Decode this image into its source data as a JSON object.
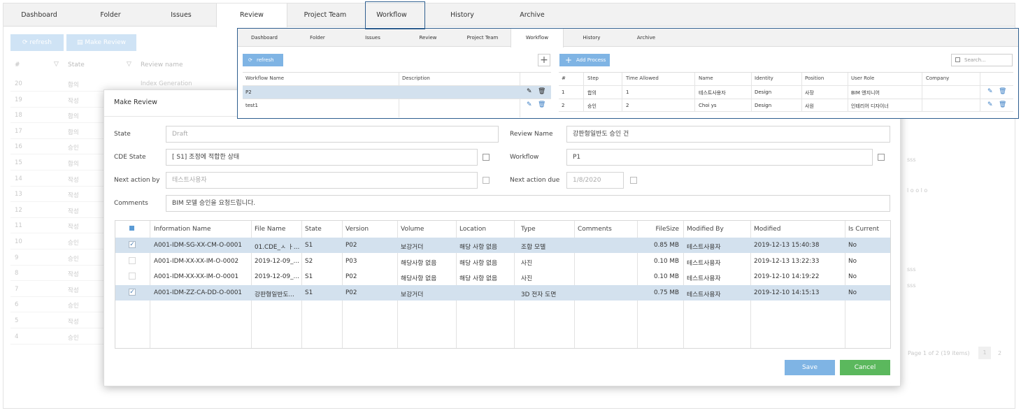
{
  "bg": {
    "tabs": [
      "Dashboard",
      "Folder",
      "Issues",
      "Review",
      "Project Team",
      "Workflow",
      "History",
      "Archive"
    ],
    "active_tab": "Review",
    "refresh_label": "refresh",
    "make_review_label": "Make Review",
    "header": {
      "number": "#",
      "state": "State",
      "name": "Review name"
    },
    "rows": [
      {
        "no": "20",
        "state": "합의",
        "name": "Index Generation"
      },
      {
        "no": "19",
        "state": "작성",
        "name": ""
      },
      {
        "no": "18",
        "state": "합의",
        "name": ""
      },
      {
        "no": "17",
        "state": "합의",
        "name": ""
      },
      {
        "no": "16",
        "state": "승인",
        "name": ""
      },
      {
        "no": "15",
        "state": "합의",
        "name": ""
      },
      {
        "no": "14",
        "state": "작성",
        "name": ""
      },
      {
        "no": "13",
        "state": "작성",
        "name": ""
      },
      {
        "no": "12",
        "state": "작성",
        "name": ""
      },
      {
        "no": "11",
        "state": "작성",
        "name": ""
      },
      {
        "no": "10",
        "state": "승인",
        "name": ""
      },
      {
        "no": "9",
        "state": "승인",
        "name": ""
      },
      {
        "no": "8",
        "state": "작성",
        "name": ""
      },
      {
        "no": "7",
        "state": "작성",
        "name": ""
      },
      {
        "no": "6",
        "state": "승인",
        "name": ""
      },
      {
        "no": "5",
        "state": "작성",
        "name": ""
      },
      {
        "no": "4",
        "state": "승인",
        "name": ""
      }
    ],
    "right_snippets": [
      "sss",
      "l o o l o",
      "sss",
      "sss"
    ],
    "pagination": {
      "text": "Page 1 of 2 (19 items)",
      "pages": [
        "1",
        "2"
      ]
    }
  },
  "modal": {
    "title": "Make Review",
    "labels": {
      "state": "State",
      "cde_state": "CDE State",
      "next_action_by": "Next action by",
      "comments": "Comments",
      "review_name": "Review Name",
      "workflow": "Workflow",
      "next_action_due": "Next action due"
    },
    "values": {
      "state": "Draft",
      "cde_state": "[ S1] 조정에 적합한 상태",
      "next_action_by": "테스트사용자",
      "comments": "BIM 모델 승인을 요청드립니다.",
      "review_name": "강판형일반도 승인 건",
      "workflow": "P1",
      "next_action_due": "1/8/2020"
    },
    "table": {
      "headers": [
        "Information Name",
        "File Name",
        "State",
        "Version",
        "Volume",
        "Location",
        "Type",
        "Comments",
        "FileSize",
        "Modified By",
        "Modified",
        "Is Current"
      ],
      "rows": [
        {
          "checked": true,
          "info": "A001-IDM-SG-XX-CM-O-0001",
          "file": "01.CDE_ㅅ ㅏ...",
          "state": "S1",
          "version": "P02",
          "volume": "보강거더",
          "location": "해당 사항 없음",
          "type": "조합 모델",
          "comments": "",
          "size": "0.85 MB",
          "by": "테스트사용자",
          "modified": "2019-12-13 15:40:38",
          "current": "No"
        },
        {
          "checked": false,
          "info": "A001-IDM-XX-XX-IM-O-0002",
          "file": "2019-12-09_...",
          "state": "S2",
          "version": "P03",
          "volume": "해당사항 없음",
          "location": "해당 사항 없음",
          "type": "사진",
          "comments": "",
          "size": "0.10 MB",
          "by": "테스트사용자",
          "modified": "2019-12-13 13:22:33",
          "current": "No"
        },
        {
          "checked": false,
          "info": "A001-IDM-XX-XX-IM-O-0001",
          "file": "2019-12-09_...",
          "state": "S1",
          "version": "P02",
          "volume": "해당사항 없음",
          "location": "해당 사항 없음",
          "type": "사진",
          "comments": "",
          "size": "0.10 MB",
          "by": "테스트사용자",
          "modified": "2019-12-10 14:19:22",
          "current": "No"
        },
        {
          "checked": true,
          "info": "A001-IDM-ZZ-CA-DD-O-0001",
          "file": "강판형일반도...",
          "state": "S1",
          "version": "P02",
          "volume": "보강거더",
          "location": "",
          "type": "3D 전자 도면",
          "comments": "",
          "size": "0.75 MB",
          "by": "테스트사용자",
          "modified": "2019-12-10 14:15:13",
          "current": "No"
        }
      ]
    },
    "save_label": "Save",
    "cancel_label": "Cancel"
  },
  "workflow_panel": {
    "tabs": [
      "Dashboard",
      "Folder",
      "Issues",
      "Review",
      "Project Team",
      "Workflow",
      "History",
      "Archive"
    ],
    "active_tab": "Workflow",
    "refresh_label": "refresh",
    "add_process_label": "Add Process",
    "search_placeholder": "Search...",
    "left_headers": [
      "Workflow Name",
      "Description"
    ],
    "left_rows": [
      {
        "name": "P2",
        "desc": ""
      },
      {
        "name": "test1",
        "desc": ""
      }
    ],
    "right_headers": [
      "#",
      "Step",
      "Time Allowed",
      "Name",
      "Identity",
      "Position",
      "User Role",
      "Company"
    ],
    "right_rows": [
      {
        "no": "1",
        "step": "합의",
        "time": "1",
        "name": "테스트사용자",
        "identity": "Design",
        "position": "사장",
        "role": "BIM 엔지니어",
        "company": ""
      },
      {
        "no": "2",
        "step": "승인",
        "time": "2",
        "name": "Choi ys",
        "identity": "Design",
        "position": "사원",
        "role": "인테리어 디자이너",
        "company": ""
      }
    ]
  },
  "colors": {
    "accent": "#7fb4e4",
    "cancel": "#5bb85d",
    "selected_row": "#d3e1ee",
    "callout": "#2f5f8f"
  }
}
